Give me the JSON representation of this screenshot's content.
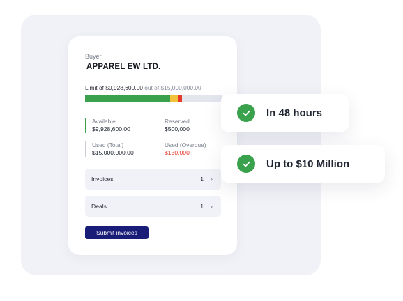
{
  "buyer": {
    "label": "Buyer",
    "name": "APPAREL EW LTD."
  },
  "limit": {
    "prefix": "Limit of ",
    "used_amount": "$9,928,600.00",
    "separator": " out of ",
    "total_amount": "$15,000,000.00",
    "progress": [
      {
        "fraction": 0.62,
        "color": "#3aa14d"
      },
      {
        "fraction": 0.06,
        "color": "#f2c23a"
      },
      {
        "fraction": 0.03,
        "color": "#e5392c"
      },
      {
        "fraction": 0.29,
        "color": "#e4e6ee"
      }
    ]
  },
  "stats": {
    "available": {
      "label": "Available",
      "value": "$9,928,600.00",
      "color": "#3aa14d"
    },
    "reserved": {
      "label": "Reserved",
      "value": "$500,000",
      "color": "#f2c23a"
    },
    "used_total": {
      "label": "Used (Total)",
      "value": "$15,000,000.00",
      "color": "#c9ccd6"
    },
    "used_overdue": {
      "label": "Used (Overdue)",
      "value": "$130,000",
      "color": "#e5392c"
    }
  },
  "rows": [
    {
      "label": "Invoices",
      "count": "1"
    },
    {
      "label": "Deals",
      "count": "1"
    }
  ],
  "submit_label": "Submit invoices",
  "pills": [
    {
      "text": "In 48 hours",
      "icon": "check-icon"
    },
    {
      "text": "Up to $10 Million",
      "icon": "check-icon"
    }
  ],
  "colors": {
    "accent_green": "#3aa14d",
    "button_navy": "#191d78",
    "overdue_red": "#e5392c"
  }
}
